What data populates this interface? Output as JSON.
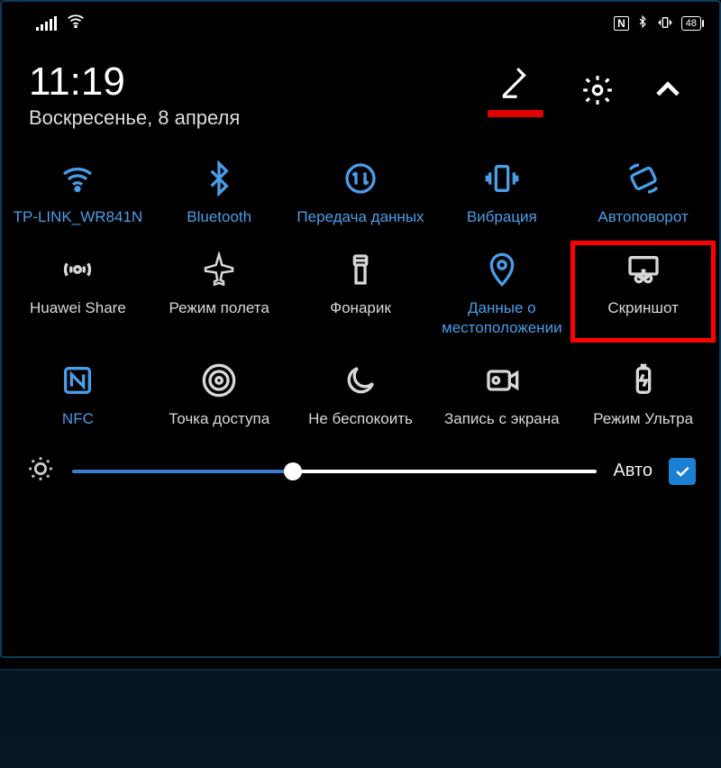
{
  "status": {
    "battery": "48"
  },
  "header": {
    "time": "11:19",
    "date": "Воскресенье, 8 апреля"
  },
  "tiles": [
    {
      "label": "TP-LINK_WR841N",
      "active": true
    },
    {
      "label": "Bluetooth",
      "active": true
    },
    {
      "label": "Передача данных",
      "active": true
    },
    {
      "label": "Вибрация",
      "active": true
    },
    {
      "label": "Автоповорот",
      "active": true
    },
    {
      "label": "Huawei Share",
      "active": false
    },
    {
      "label": "Режим полета",
      "active": false
    },
    {
      "label": "Фонарик",
      "active": false
    },
    {
      "label": "Данные о местоположении",
      "active": true
    },
    {
      "label": "Скриншот",
      "active": false
    },
    {
      "label": "NFC",
      "active": true
    },
    {
      "label": "Точка доступа",
      "active": false
    },
    {
      "label": "Не беспокоить",
      "active": false
    },
    {
      "label": "Запись с экрана",
      "active": false
    },
    {
      "label": "Режим Ультра",
      "active": false
    }
  ],
  "brightness": {
    "auto_label": "Авто",
    "auto_checked": true
  }
}
